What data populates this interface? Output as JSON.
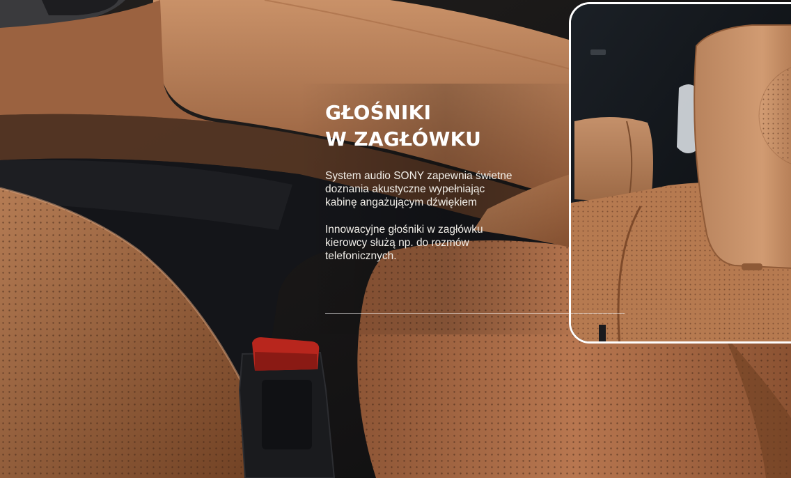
{
  "feature": {
    "title_line_1": "GŁOŚNIKI",
    "title_line_2": "W ZAGŁÓWKU",
    "paragraph_1": "System audio SONY zapewnia świetne doznania akustyczne wypełniając kabinę angażującym dźwiękiem",
    "paragraph_2": "Innowacyjne głośniki w zagłówku kierowcy służą np. do rozmów telefonicznych."
  },
  "colors": {
    "leather": "#b5764a",
    "leather_light": "#cc9167",
    "dark_trim": "#141519",
    "buckle_red": "#b8261d",
    "text": "#ffffff"
  },
  "images": {
    "background": "car-interior-leather-seats",
    "inset": "headrest-speaker-closeup"
  }
}
